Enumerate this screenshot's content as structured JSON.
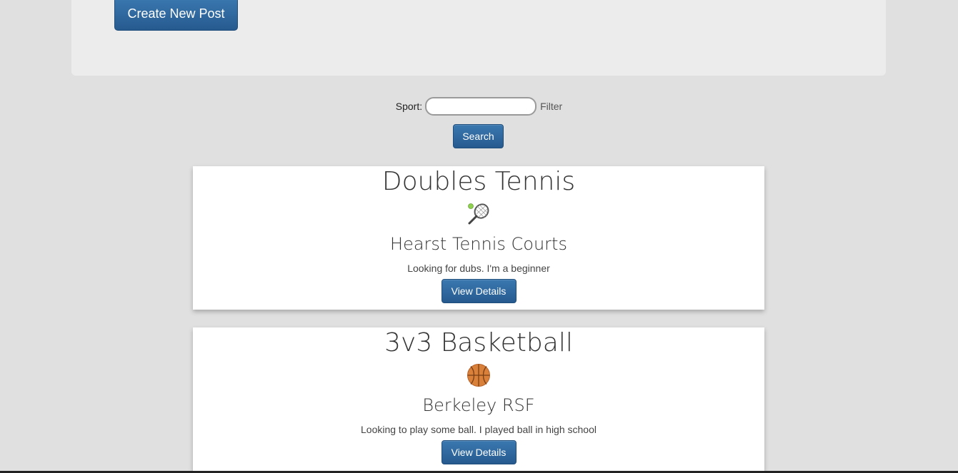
{
  "header": {
    "create_button_label": "Create New Post"
  },
  "filter": {
    "label": "Sport:",
    "input_value": "",
    "hint": "Filter",
    "search_button_label": "Search"
  },
  "posts": [
    {
      "title": "Doubles Tennis",
      "icon": "tennis-racket-icon",
      "location": "Hearst Tennis Courts",
      "description": "Looking for dubs. I'm a beginner",
      "button_label": "View Details"
    },
    {
      "title": "3v3 Basketball",
      "icon": "basketball-icon",
      "location": "Berkeley RSF",
      "description": "Looking to play some ball. I played ball in high school",
      "button_label": "View Details"
    }
  ],
  "colors": {
    "page_background": "#e0e0e0",
    "jumbotron_background": "#ececec",
    "button_primary": "#2e6da4",
    "card_background": "#ffffff"
  }
}
